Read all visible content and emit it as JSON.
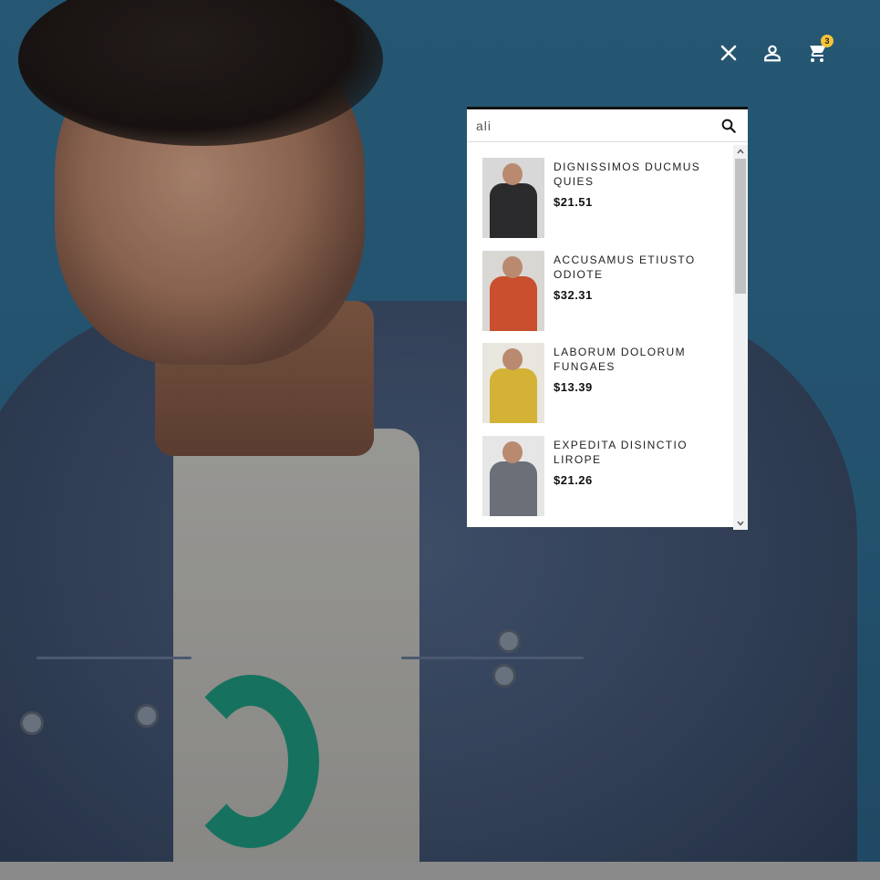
{
  "header": {
    "close_icon": "close-icon",
    "account_icon": "account-icon",
    "cart_icon": "cart-icon",
    "cart_count": "3",
    "cart_badge_color": "#f6c33a"
  },
  "search": {
    "value": "ali",
    "placeholder": "",
    "button_icon": "search-icon"
  },
  "results": [
    {
      "name": "DIGNISSIMOS DUCMUS QUIES",
      "price": "$21.51",
      "thumb_colors": [
        "#2b2b2e",
        "#d8d8d8"
      ]
    },
    {
      "name": "ACCUSAMUS ETIUSTO ODIOTE",
      "price": "$32.31",
      "thumb_colors": [
        "#c94f2e",
        "#d9d7d3"
      ]
    },
    {
      "name": "LABORUM DOLORUM FUNGAES",
      "price": "$13.39",
      "thumb_colors": [
        "#d4b236",
        "#e9e5df"
      ]
    },
    {
      "name": "EXPEDITA DISINCTIO LIROPE",
      "price": "$21.26",
      "thumb_colors": [
        "#6b6f78",
        "#e6e6e6"
      ]
    }
  ],
  "colors": {
    "hero_background": "#2e6a8c",
    "panel_border": "#111111",
    "bottom_bar": "#8a8a8a"
  }
}
